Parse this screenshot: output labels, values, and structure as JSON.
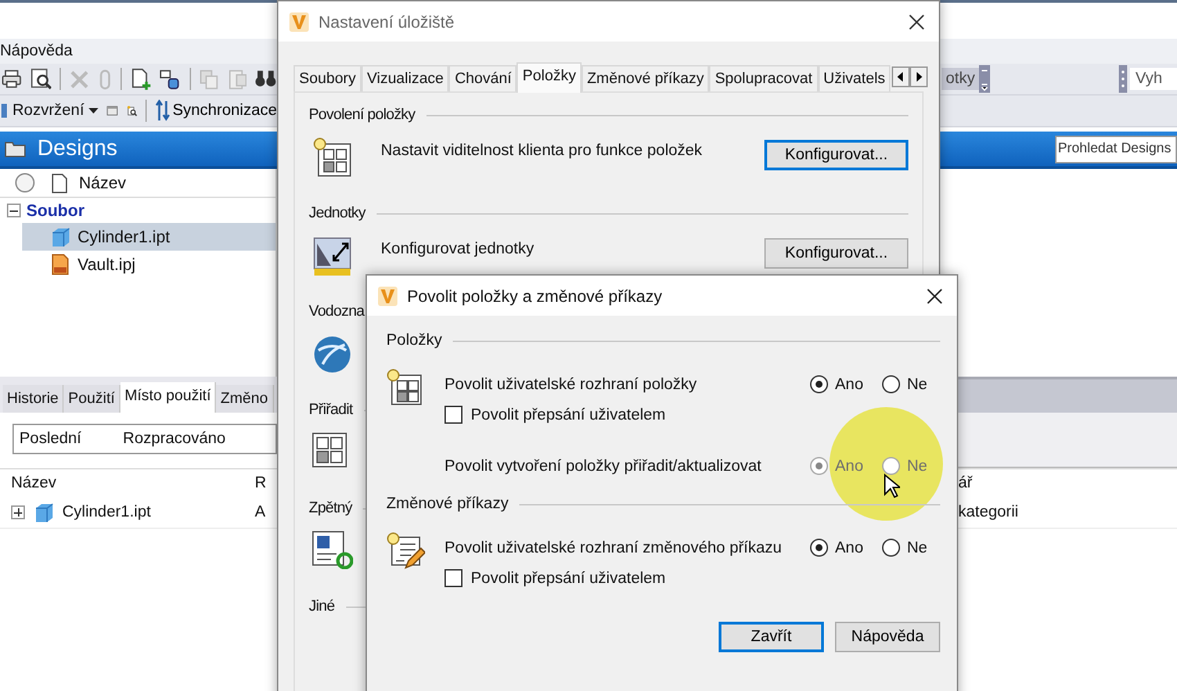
{
  "menu_bar": {
    "items": [
      "Nápověda"
    ]
  },
  "toolbar": {
    "layout_menu": "Rozvržení",
    "sync_button": "Synchronizace",
    "units_fragment": "otky",
    "search_fragment": "Vyh"
  },
  "vault_header": {
    "title": "Designs",
    "search": {
      "placeholder": "Prohledat Designs"
    }
  },
  "tree": {
    "column": "Název",
    "groups": [
      {
        "label": "Soubor",
        "expanded": true,
        "children": [
          {
            "name": "Cylinder1.ipt",
            "kind": "part",
            "selected": true
          },
          {
            "name": "Vault.ipj",
            "kind": "project",
            "selected": false
          }
        ]
      }
    ]
  },
  "detail_pane": {
    "tabs": [
      {
        "label": "Historie",
        "selected": false
      },
      {
        "label": "Použití",
        "selected": false
      },
      {
        "label": "Místo použití",
        "selected": true
      },
      {
        "label": "Změno",
        "selected": false
      }
    ],
    "filter": [
      "Poslední",
      "Rozpracováno"
    ],
    "table": {
      "columns": [
        "Název",
        "R",
        "ář"
      ],
      "rows": [
        {
          "cells": [
            "Cylinder1.ipt",
            "A",
            "kategorii"
          ],
          "expanded": false
        }
      ]
    }
  },
  "settings_dialog": {
    "title": "Nastavení úložiště",
    "tabs": [
      {
        "label": "Soubory",
        "selected": false
      },
      {
        "label": "Vizualizace",
        "selected": false
      },
      {
        "label": "Chování",
        "selected": false
      },
      {
        "label": "Položky",
        "selected": true
      },
      {
        "label": "Změnové příkazy",
        "selected": false
      },
      {
        "label": "Spolupracovat",
        "selected": false
      },
      {
        "label": "Uživatels",
        "selected": false
      }
    ],
    "sections": [
      {
        "title": "Povolení položky",
        "kind": "items",
        "text": "Nastavit viditelnost klienta pro funkce položek",
        "button": {
          "label": "Konfigurovat...",
          "focused": true
        }
      },
      {
        "title": "Jednotky",
        "kind": "units",
        "text": "Konfigurovat jednotky",
        "button": {
          "label": "Konfigurovat...",
          "focused": false
        }
      },
      {
        "title": "Vodozna",
        "kind": "globe"
      },
      {
        "title": "Přiřadit",
        "kind": "grid"
      },
      {
        "title": "Zpětný",
        "kind": "sync"
      },
      {
        "title": "Jiné",
        "kind": "none"
      }
    ]
  },
  "enable_dialog": {
    "title": "Povolit položky a změnové příkazy",
    "groups": [
      {
        "title": "Položky",
        "kind": "items",
        "rows": [
          {
            "kind": "radio",
            "label": "Povolit uživatelské rozhraní položky",
            "options": [
              {
                "label": "Ano",
                "selected": true,
                "disabled": false
              },
              {
                "label": "Ne",
                "selected": false,
                "disabled": false
              }
            ]
          },
          {
            "kind": "checkbox",
            "label": "Povolit přepsání uživatelem",
            "checked": false
          },
          {
            "kind": "radio",
            "label": "Povolit vytvoření položky přiřadit/aktualizovat",
            "options": [
              {
                "label": "Ano",
                "selected": true,
                "disabled": true
              },
              {
                "label": "Ne",
                "selected": false,
                "disabled": true
              }
            ]
          }
        ]
      },
      {
        "title": "Změnové příkazy",
        "kind": "changes",
        "rows": [
          {
            "kind": "radio",
            "label": "Povolit uživatelské rozhraní změnového příkazu",
            "options": [
              {
                "label": "Ano",
                "selected": true,
                "disabled": false
              },
              {
                "label": "Ne",
                "selected": false,
                "disabled": false
              }
            ]
          },
          {
            "kind": "checkbox",
            "label": "Povolit přepsání uživatelem",
            "checked": false
          }
        ]
      }
    ],
    "buttons": [
      {
        "label": "Zavřít",
        "default": true
      },
      {
        "label": "Nápověda",
        "default": false
      }
    ]
  }
}
